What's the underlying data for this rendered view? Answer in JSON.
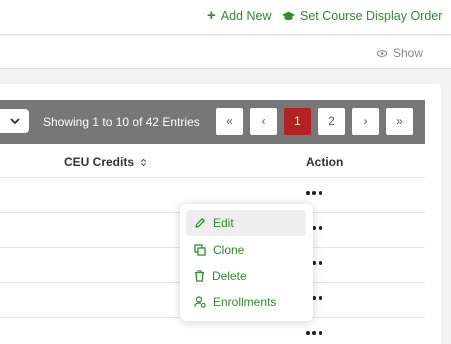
{
  "toolbar": {
    "add_new_label": "Add New",
    "set_order_label": "Set Course Display Order",
    "show_label": "Show"
  },
  "pagination": {
    "showing_text": "Showing 1 to 10 of 42 Entries",
    "first": "«",
    "prev": "‹",
    "pages": [
      "1",
      "2"
    ],
    "current_page": "1",
    "next": "›",
    "last": "»"
  },
  "table": {
    "columns": [
      "CEU Credits",
      "Action"
    ]
  },
  "action_menu": {
    "items": [
      "Edit",
      "Clone",
      "Delete",
      "Enrollments"
    ]
  },
  "colors": {
    "accent_green": "#2e8b2e",
    "active_page": "#b22222",
    "pager_bar": "#777777"
  }
}
